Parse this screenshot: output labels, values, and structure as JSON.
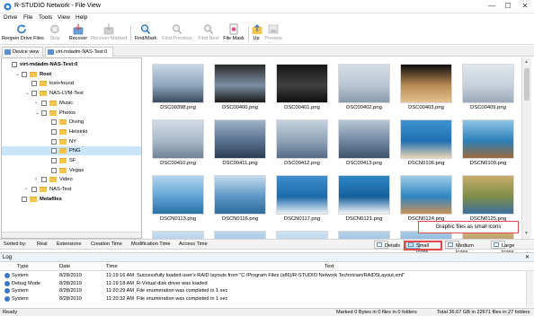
{
  "window": {
    "title": "R-STUDIO Network - File View",
    "min_glyph": "—",
    "max_glyph": "☐",
    "close_glyph": "✕"
  },
  "menu": [
    "Drive",
    "File",
    "Tools",
    "View",
    "Help"
  ],
  "toolbar": [
    {
      "label": "Reopen Drive Files",
      "icon": "refresh-icon",
      "enabled": true
    },
    {
      "label": "Stop",
      "icon": "stop-icon",
      "enabled": false
    },
    {
      "label": "Recover",
      "icon": "recover-icon",
      "enabled": true
    },
    {
      "label": "Recover Marked",
      "icon": "recover-marked-icon",
      "enabled": false
    },
    {
      "label": "Find/Mark",
      "icon": "find-icon",
      "enabled": true
    },
    {
      "label": "Find Previous",
      "icon": "find-previous-icon",
      "enabled": false
    },
    {
      "label": "Find Next",
      "icon": "find-next-icon",
      "enabled": false
    },
    {
      "label": "File Mask",
      "icon": "file-mask-icon",
      "enabled": true
    },
    {
      "label": "Up",
      "icon": "up-folder-icon",
      "enabled": true
    },
    {
      "label": "Preview",
      "icon": "preview-icon",
      "enabled": false
    }
  ],
  "tabs": [
    "Device view",
    "virt-mdadm-NAS-Test:0"
  ],
  "tree": [
    {
      "label": "virt-mdadm-NAS-Test:0",
      "level": 0,
      "expander": "",
      "bold": true,
      "folder": false
    },
    {
      "label": "Root",
      "level": 1,
      "expander": "v",
      "bold": true,
      "folder": true
    },
    {
      "label": "lost+found",
      "level": 2,
      "expander": "",
      "bold": false,
      "folder": true
    },
    {
      "label": "NAS-LVM-Test",
      "level": 2,
      "expander": "v",
      "bold": false,
      "folder": true
    },
    {
      "label": "Music",
      "level": 3,
      "expander": ">",
      "bold": false,
      "folder": true
    },
    {
      "label": "Photos",
      "level": 3,
      "expander": "v",
      "bold": false,
      "folder": true
    },
    {
      "label": "Diving",
      "level": 4,
      "expander": "",
      "bold": false,
      "folder": true
    },
    {
      "label": "Helsinki",
      "level": 4,
      "expander": "",
      "bold": false,
      "folder": true
    },
    {
      "label": "NY",
      "level": 4,
      "expander": "",
      "bold": false,
      "folder": true
    },
    {
      "label": "PNG",
      "level": 4,
      "expander": "",
      "bold": false,
      "folder": true,
      "selected": true
    },
    {
      "label": "SF",
      "level": 4,
      "expander": "",
      "bold": false,
      "folder": true
    },
    {
      "label": "Vegas",
      "level": 4,
      "expander": "",
      "bold": false,
      "folder": true
    },
    {
      "label": "Video",
      "level": 3,
      "expander": ">",
      "bold": false,
      "folder": true
    },
    {
      "label": "NAS-Test",
      "level": 2,
      "expander": ">",
      "bold": false,
      "folder": true
    },
    {
      "label": "Metafiles",
      "level": 1,
      "expander": "",
      "bold": true,
      "folder": true
    }
  ],
  "files": [
    {
      "name": "DSC00398.png",
      "colors": [
        "#c9d7e6",
        "#8fa6bd",
        "#3a4a5c"
      ]
    },
    {
      "name": "DSC00400.png",
      "colors": [
        "#2a2a2a",
        "#7d8ea3",
        "#1a1a1a"
      ]
    },
    {
      "name": "DSC00401.png",
      "colors": [
        "#151515",
        "#404040",
        "#0d0d0d"
      ]
    },
    {
      "name": "DSC00402.png",
      "colors": [
        "#d5dde6",
        "#b9c6d3",
        "#8a9aab"
      ]
    },
    {
      "name": "DSC00403.png",
      "colors": [
        "#0c0c0c",
        "#b98a54",
        "#e2c08d"
      ]
    },
    {
      "name": "DSC00409.png",
      "colors": [
        "#e0e6ec",
        "#c7d1db",
        "#9aa9b8"
      ]
    },
    {
      "name": "DSC00410.png",
      "colors": [
        "#d2dbe4",
        "#a9b9c9",
        "#6e8196"
      ]
    },
    {
      "name": "DSC00411.png",
      "colors": [
        "#9fb3c8",
        "#58718d",
        "#2d3d52"
      ]
    },
    {
      "name": "DSC00412.png",
      "colors": [
        "#c6d2de",
        "#8ea3b8",
        "#526a84"
      ]
    },
    {
      "name": "DSC00413.png",
      "colors": [
        "#b8c7d6",
        "#6f87a0",
        "#3e536a"
      ]
    },
    {
      "name": "DSCN0106.png",
      "colors": [
        "#3f93d0",
        "#1f6fb0",
        "#e8d6b5"
      ]
    },
    {
      "name": "DSCN0109.png",
      "colors": [
        "#8fc6e6",
        "#2d7fb8",
        "#9b6a3c"
      ]
    },
    {
      "name": "DSCN0113.png",
      "colors": [
        "#b2d6ee",
        "#5fa3d3",
        "#2a6fa6"
      ]
    },
    {
      "name": "DSCN0116.png",
      "colors": [
        "#c4dbee",
        "#5c96c5",
        "#2f6a9c"
      ]
    },
    {
      "name": "DSCN0117.png",
      "colors": [
        "#3c8fcf",
        "#1d6aa9",
        "#e9f1f7"
      ]
    },
    {
      "name": "DSCN0121.png",
      "colors": [
        "#2f86c5",
        "#155f9b",
        "#f4f7fa"
      ]
    },
    {
      "name": "DSCN0124.png",
      "colors": [
        "#9ccbe8",
        "#2f86c1",
        "#c98f54"
      ]
    },
    {
      "name": "DSCN0125.png",
      "colors": [
        "#c8ab6a",
        "#7c8d4a",
        "#3d6f9c"
      ]
    },
    {
      "name": "",
      "colors": [
        "#c9ddef",
        "#9cc1e2",
        "#7aa9d4"
      ]
    },
    {
      "name": "",
      "colors": [
        "#bcd6ec",
        "#8ab6dd",
        "#5f96c8"
      ]
    },
    {
      "name": "",
      "colors": [
        "#cde1f1",
        "#a5c6e4",
        "#7faad3"
      ]
    },
    {
      "name": "",
      "colors": [
        "#b6d2ea",
        "#7fb0da",
        "#4f8ac2"
      ]
    },
    {
      "name": "",
      "colors": [
        "#a9cbe8",
        "#6fa6d6",
        "#3f7fbd"
      ]
    },
    {
      "name": "",
      "colors": [
        "#d1b07a",
        "#9b8a56",
        "#5e7f9f"
      ]
    }
  ],
  "sortbar": {
    "sorted_by": "Sorted by:",
    "columns": [
      "Real",
      "Extensions",
      "Creation Time",
      "Modification Time",
      "Access Time"
    ],
    "views": [
      {
        "label": "Details",
        "active": false
      },
      {
        "label": "Small Icons",
        "active": true
      },
      {
        "label": "Medium Icons",
        "active": false
      },
      {
        "label": "Large Icons",
        "active": false
      }
    ]
  },
  "callout": "Graphic files as small icons",
  "log": {
    "title": "Log",
    "close_glyph": "✕",
    "columns": [
      "Type",
      "Date",
      "Time",
      "Text"
    ],
    "rows": [
      {
        "type": "System",
        "date": "8/28/2019",
        "time": "11:19:16 AM",
        "text": "Successfully loaded user's RAID layouts from \"C:/Program Files (x86)/R-STUDIO Network Technician/RAID5Layout.xml\""
      },
      {
        "type": "Debug Mode",
        "date": "8/28/2019",
        "time": "11:19:18 AM",
        "text": "R-Virtual disk driver was loaded"
      },
      {
        "type": "System",
        "date": "8/28/2019",
        "time": "11:20:29 AM",
        "text": "File enumeration was completed in 1 sec"
      },
      {
        "type": "System",
        "date": "8/28/2019",
        "time": "11:20:32 AM",
        "text": "File enumeration was completed in 1 sec"
      }
    ]
  },
  "status": {
    "left": "Ready",
    "marked": "Marked 0 Bytes in 0 files in 0 folders",
    "total": "Total 36.67 GB in 22671 files in 27 folders"
  },
  "colors": {
    "accent": "#0078d7",
    "callout_border": "#e14a4a",
    "selection": "#cce4f7"
  }
}
